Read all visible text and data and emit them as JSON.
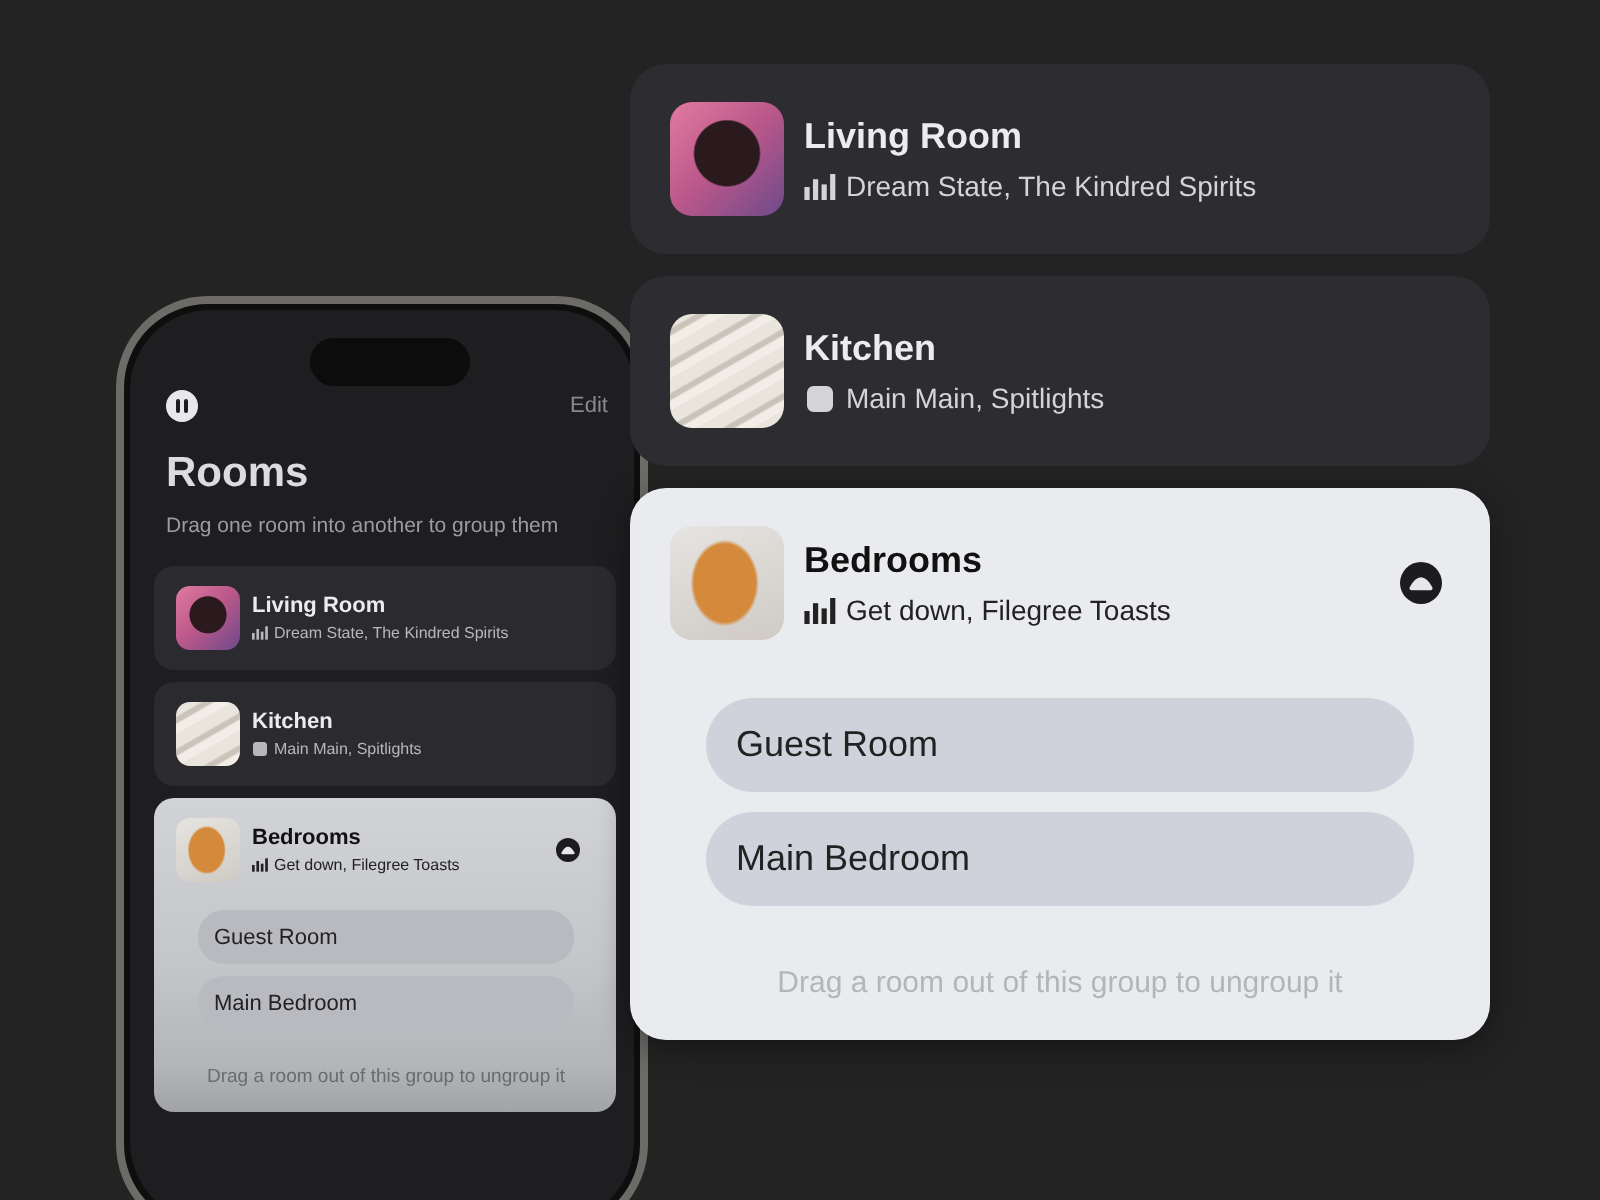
{
  "phone": {
    "edit_label": "Edit",
    "title": "Rooms",
    "subtitle": "Drag one room into another to group them",
    "rooms": [
      {
        "name": "Living Room",
        "now_playing": "Dream State, The Kindred Spirits",
        "status": {
          "kind": "playing"
        },
        "art": {
          "kind": "portrait"
        },
        "expanded": false
      },
      {
        "name": "Kitchen",
        "now_playing": "Main Main, Spitlights",
        "status": {
          "kind": "stopped"
        },
        "art": {
          "kind": "texture"
        },
        "expanded": false
      },
      {
        "name": "Bedrooms",
        "now_playing": "Get down, Filegree Toasts",
        "status": {
          "kind": "playing"
        },
        "art": {
          "kind": "toast"
        },
        "expanded": true,
        "subrooms": [
          "Guest Room",
          "Main Bedroom"
        ],
        "hint": "Drag a room out of this group to ungroup it"
      }
    ]
  },
  "zoomed_cards": [
    {
      "name": "Living Room",
      "now_playing": "Dream State, The Kindred Spirits",
      "status": {
        "kind": "playing"
      },
      "art": {
        "kind": "portrait"
      },
      "expanded": false
    },
    {
      "name": "Kitchen",
      "now_playing": "Main Main, Spitlights",
      "status": {
        "kind": "stopped"
      },
      "art": {
        "kind": "texture"
      },
      "expanded": false
    },
    {
      "name": "Bedrooms",
      "now_playing": "Get down, Filegree Toasts",
      "status": {
        "kind": "playing"
      },
      "art": {
        "kind": "toast"
      },
      "expanded": true,
      "subrooms": [
        "Guest Room",
        "Main Bedroom"
      ],
      "hint": "Drag a room out of this group to ungroup it"
    }
  ]
}
